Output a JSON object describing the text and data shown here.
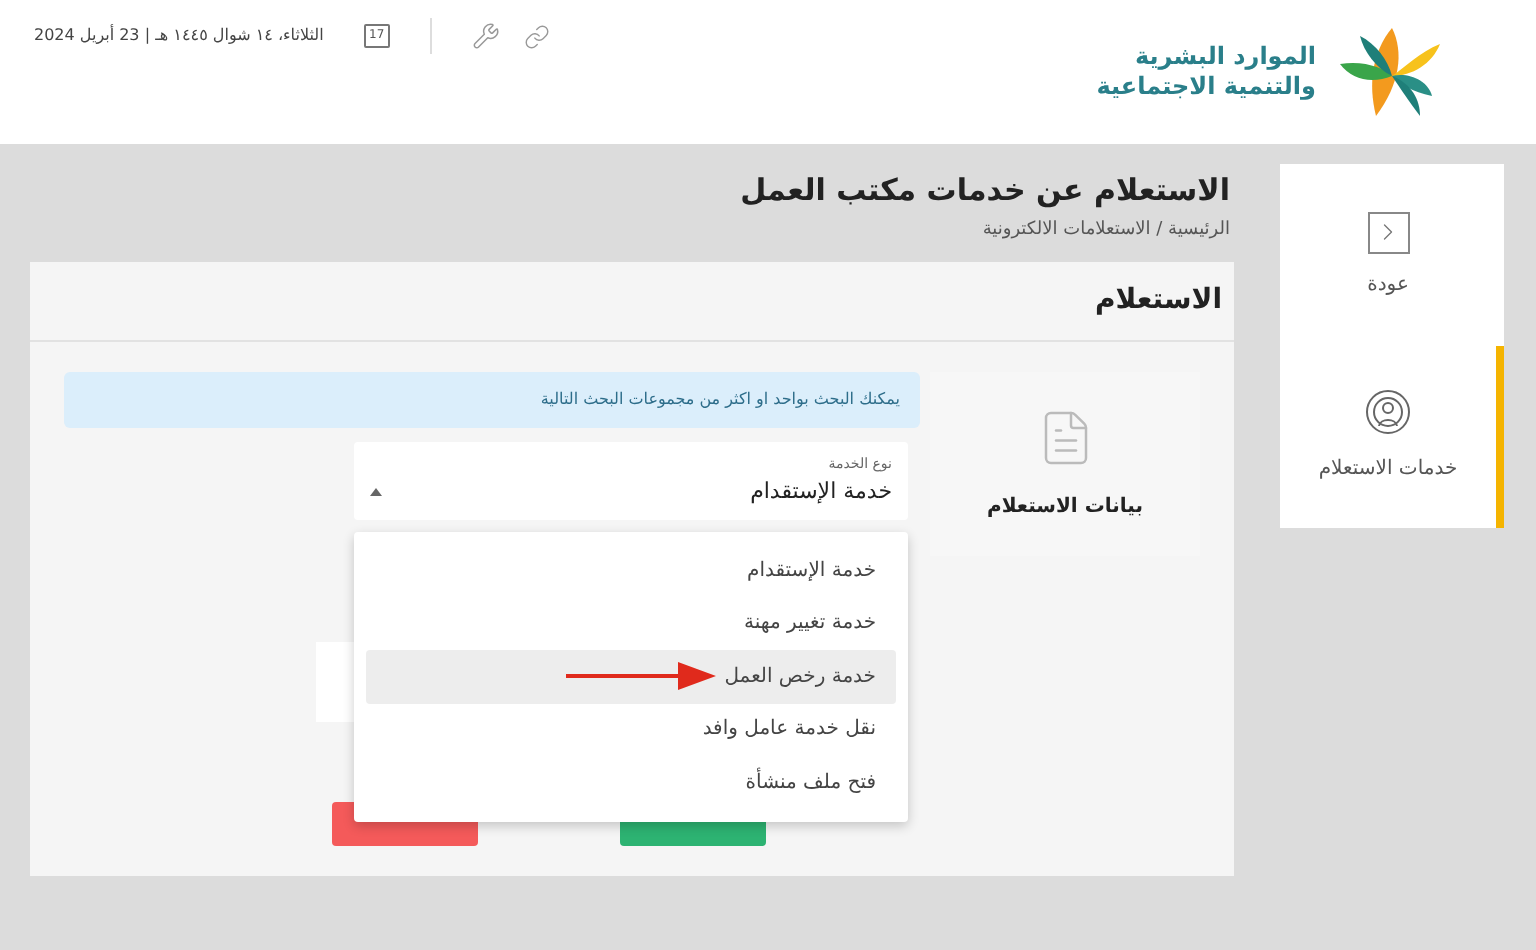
{
  "header": {
    "logo_lines": [
      "الموارد البشرية",
      "والتنمية الاجتماعية"
    ],
    "calendar_day": "17",
    "date": "الثلاثاء، ١٤ شوال ١٤٤٥ هـ | 23 أبريل 2024"
  },
  "sidebar": {
    "items": [
      {
        "label": "عودة",
        "kind": "back",
        "selected": false
      },
      {
        "label": "خدمات الاستعلام",
        "kind": "inquiry",
        "selected": true
      }
    ]
  },
  "page_title": "الاستعلام عن خدمات مكتب العمل",
  "breadcrumb": "الرئيسية / الاستعلامات الالكترونية",
  "panel": {
    "title": "الاستعلام",
    "section_label": "بيانات الاستعلام",
    "info": "يمكنك البحث بواحد او اكثر من مجموعات البحث التالية",
    "select": {
      "label": "نوع الخدمة",
      "value": "خدمة الإستقدام"
    },
    "menu_items": [
      {
        "label": "خدمة الإستقدام",
        "selected": false
      },
      {
        "label": "خدمة تغيير مهنة",
        "selected": false
      },
      {
        "label": "خدمة رخص العمل",
        "selected": true
      },
      {
        "label": "نقل خدمة عامل وافد",
        "selected": false
      },
      {
        "label": "فتح ملف منشأة",
        "selected": false
      }
    ]
  }
}
